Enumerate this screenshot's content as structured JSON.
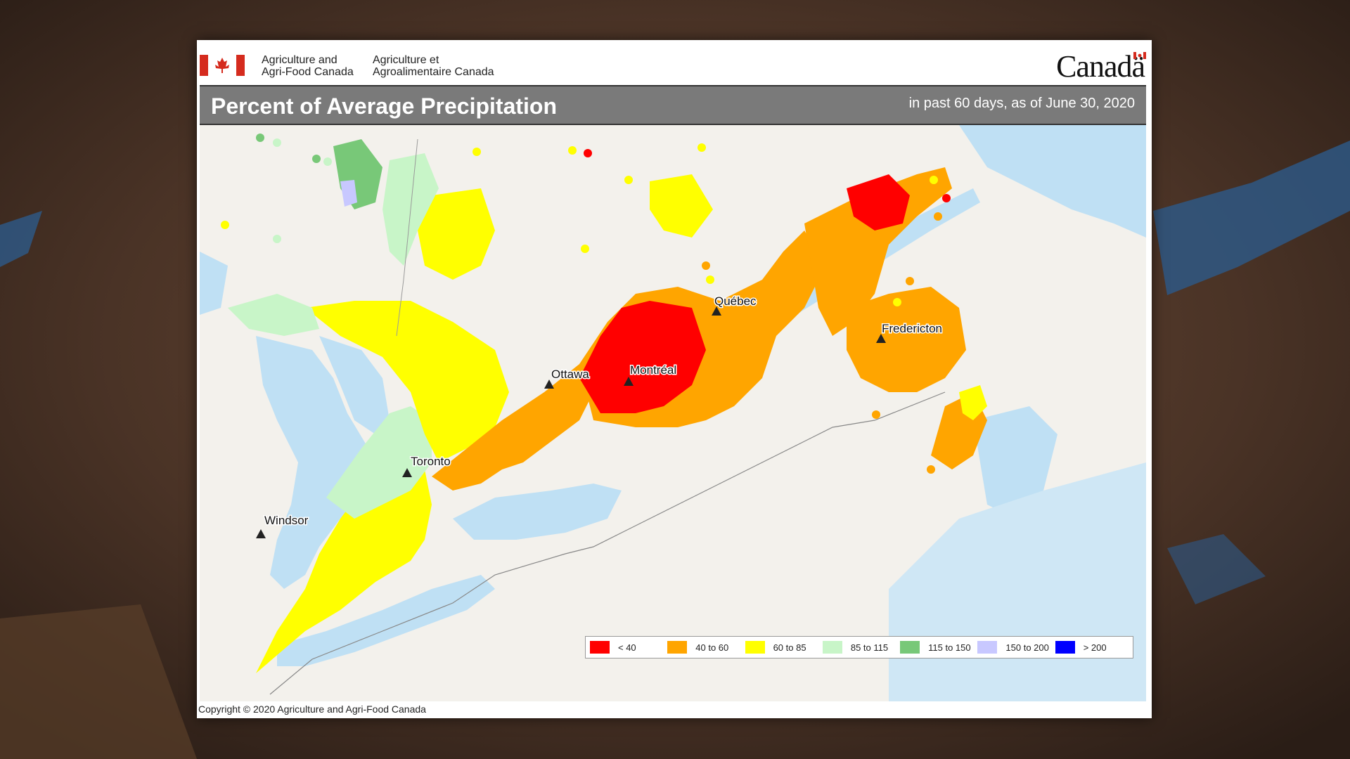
{
  "header": {
    "dept_en_line1": "Agriculture and",
    "dept_en_line2": "Agri-Food Canada",
    "dept_fr_line1": "Agriculture et",
    "dept_fr_line2": "Agroalimentaire Canada",
    "wordmark": "Canadä"
  },
  "title": "Percent of Average Precipitation",
  "subtitle": "in past 60 days, as of June 30, 2020",
  "cities": [
    {
      "name": "Québec"
    },
    {
      "name": "Fredericton"
    },
    {
      "name": "Ottawa"
    },
    {
      "name": "Montréal"
    },
    {
      "name": "Toronto"
    },
    {
      "name": "Windsor"
    }
  ],
  "legend": [
    {
      "label": "< 40",
      "color": "#ff0000"
    },
    {
      "label": "40 to 60",
      "color": "#ffa500"
    },
    {
      "label": "60 to 85",
      "color": "#ffff00"
    },
    {
      "label": "85 to 115",
      "color": "#c8f5c8"
    },
    {
      "label": "115 to 150",
      "color": "#78c878"
    },
    {
      "label": "150 to 200",
      "color": "#c8c8ff"
    },
    {
      "label": "> 200",
      "color": "#0000ff"
    }
  ],
  "copyright": "Copyright © 2020 Agriculture and Agri-Food Canada"
}
